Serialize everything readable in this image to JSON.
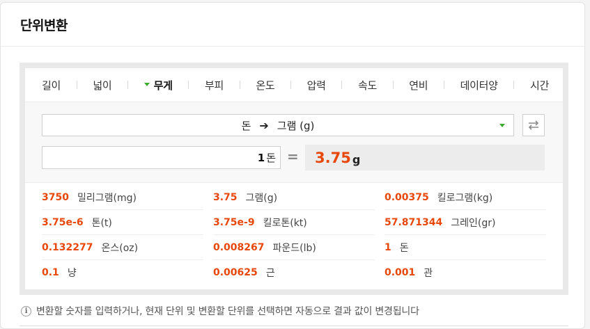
{
  "title": "단위변환",
  "tabs": [
    {
      "label": "길이",
      "active": false
    },
    {
      "label": "넓이",
      "active": false
    },
    {
      "label": "무게",
      "active": true
    },
    {
      "label": "부피",
      "active": false
    },
    {
      "label": "온도",
      "active": false
    },
    {
      "label": "압력",
      "active": false
    },
    {
      "label": "속도",
      "active": false
    },
    {
      "label": "연비",
      "active": false
    },
    {
      "label": "데이터양",
      "active": false
    },
    {
      "label": "시간",
      "active": false
    }
  ],
  "converter": {
    "from_unit": "돈",
    "arrow": "➔",
    "to_unit": "그램 (g)",
    "input_value": "1",
    "input_unit": "돈",
    "equals": "=",
    "result_value": "3.75",
    "result_unit": "g"
  },
  "results": [
    {
      "value": "3750",
      "unit": "밀리그램(mg)"
    },
    {
      "value": "3.75",
      "unit": "그램(g)"
    },
    {
      "value": "0.00375",
      "unit": "킬로그램(kg)"
    },
    {
      "value": "3.75e-6",
      "unit": "톤(t)"
    },
    {
      "value": "3.75e-9",
      "unit": "킬로톤(kt)"
    },
    {
      "value": "57.871344",
      "unit": "그레인(gr)"
    },
    {
      "value": "0.132277",
      "unit": "온스(oz)"
    },
    {
      "value": "0.008267",
      "unit": "파운드(lb)"
    },
    {
      "value": "1",
      "unit": "돈"
    },
    {
      "value": "0.1",
      "unit": "냥"
    },
    {
      "value": "0.00625",
      "unit": "근"
    },
    {
      "value": "0.001",
      "unit": "관"
    }
  ],
  "note": {
    "icon": "info-icon",
    "text": "변환할 숫자를 입력하거나, 현재 단위 및 변환할 단위를 선택하면 자동으로 결과 값이 변경됩니다"
  },
  "colors": {
    "accent_result": "#e8470a",
    "accent_arrow": "#3dab30"
  }
}
